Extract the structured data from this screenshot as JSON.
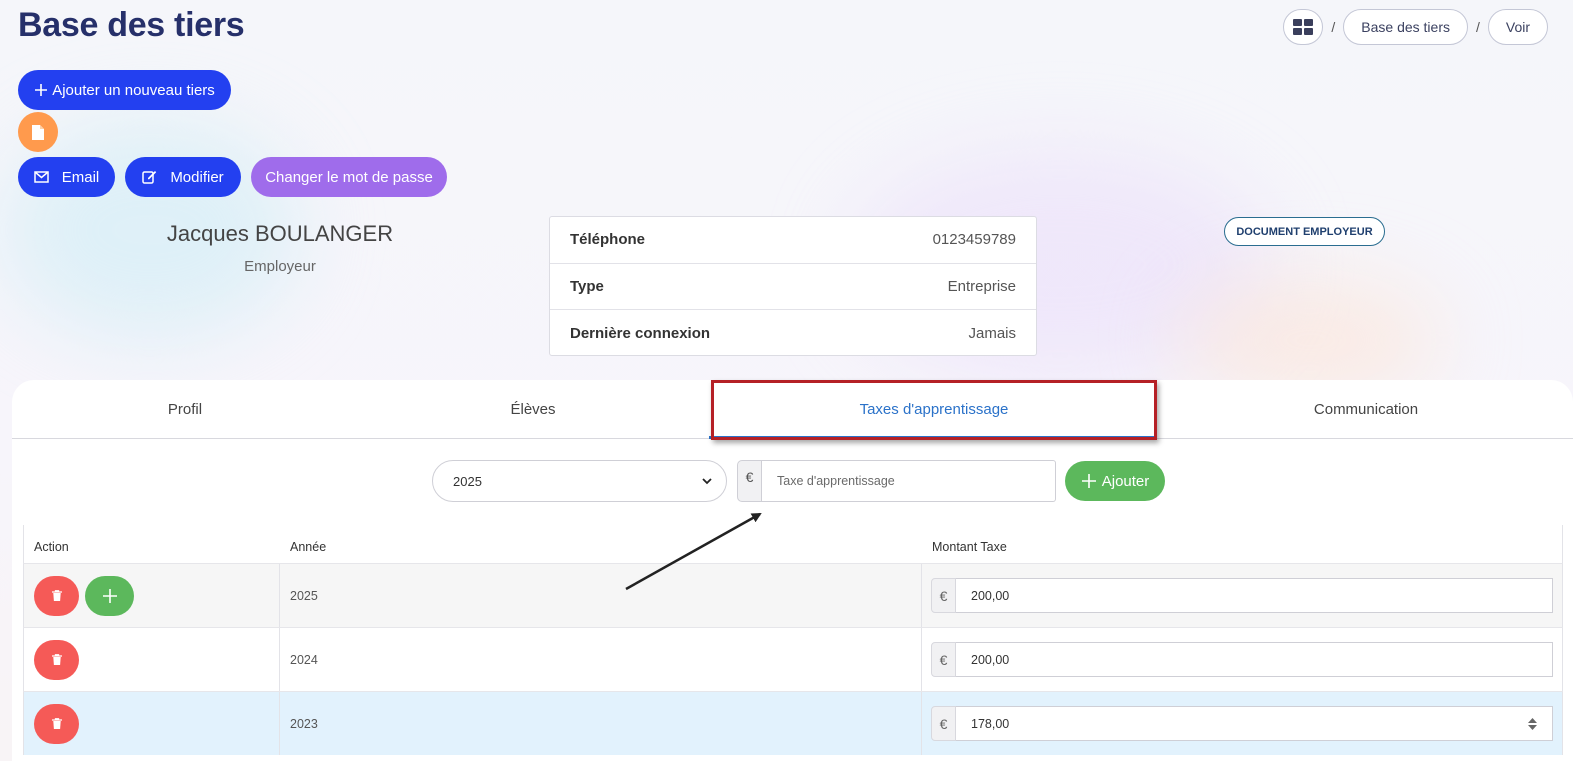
{
  "page": {
    "title": "Base des tiers"
  },
  "breadcrumb": {
    "items": [
      "Base des tiers",
      "Voir"
    ],
    "separator": "/"
  },
  "actions": {
    "add_tiers_label": "Ajouter un nouveau tiers",
    "email_label": "Email",
    "modifier_label": "Modifier",
    "password_label": "Changer le mot de passe"
  },
  "profile": {
    "name": "Jacques BOULANGER",
    "role": "Employeur",
    "badge": "DOCUMENT EMPLOYEUR",
    "info": [
      {
        "label": "Téléphone",
        "value": "0123459789"
      },
      {
        "label": "Type",
        "value": "Entreprise"
      },
      {
        "label": "Dernière connexion",
        "value": "Jamais"
      }
    ]
  },
  "tabs": [
    "Profil",
    "Élèves",
    "Taxes d'apprentissage",
    "Communication"
  ],
  "active_tab": "Taxes d'apprentissage",
  "tax_form": {
    "year_selected": "2025",
    "currency": "€",
    "placeholder": "Taxe d'apprentissage",
    "add_label": "Ajouter"
  },
  "table": {
    "headers": [
      "Action",
      "Année",
      "Montant Taxe"
    ],
    "rows": [
      {
        "year": "2025",
        "amount": "200,00"
      },
      {
        "year": "2024",
        "amount": "200,00"
      },
      {
        "year": "2023",
        "amount": "178,00"
      }
    ]
  },
  "colors": {
    "primary": "#2340f0",
    "purple": "#9f6ceb",
    "orange": "#ff9a4d",
    "success": "#5cb85c",
    "danger": "#f55a57",
    "tab_active": "#2b72c9",
    "highlight": "#b52026",
    "title": "#26306a"
  },
  "icons": {
    "breadcrumb_home": "grid-icon",
    "doc": "file-icon",
    "email": "envelope-icon",
    "modifier": "edit-icon",
    "add": "plus-icon",
    "delete": "trash-icon"
  }
}
